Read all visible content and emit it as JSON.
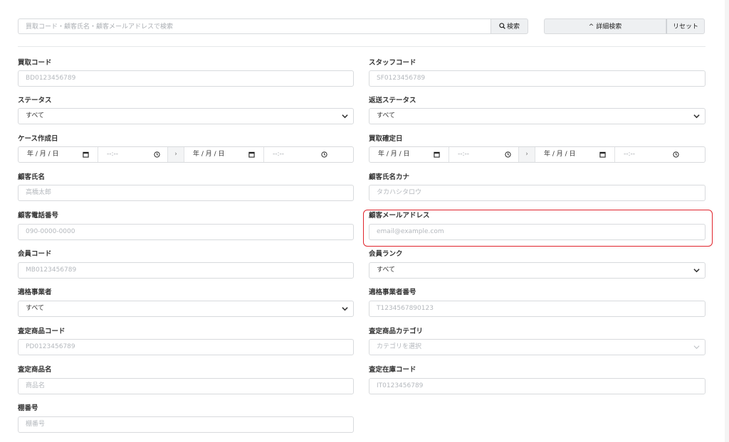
{
  "search": {
    "placeholder": "買取コード・顧客氏名・顧客メールアドレスで検索",
    "button_label": "検索",
    "advanced_label": "詳細検索",
    "reset_label": "リセット"
  },
  "fields": {
    "purchase_code": {
      "label": "買取コード",
      "placeholder": "BD0123456789"
    },
    "staff_code": {
      "label": "スタッフコード",
      "placeholder": "SF0123456789"
    },
    "status": {
      "label": "ステータス",
      "value": "すべて"
    },
    "return_status": {
      "label": "返送ステータス",
      "value": "すべて"
    },
    "case_created_date": {
      "label": "ケース作成日",
      "date_placeholder": "年 / 月 / 日",
      "time_placeholder": "--:--",
      "separator": "›"
    },
    "purchase_confirmed_date": {
      "label": "買取確定日",
      "date_placeholder": "年 / 月 / 日",
      "time_placeholder": "--:--",
      "separator": "›"
    },
    "customer_name": {
      "label": "顧客氏名",
      "placeholder": "高橋太郎"
    },
    "customer_name_kana": {
      "label": "顧客氏名カナ",
      "placeholder": "タカハシタロウ"
    },
    "customer_phone": {
      "label": "顧客電話番号",
      "placeholder": "090-0000-0000"
    },
    "customer_email": {
      "label": "顧客メールアドレス",
      "placeholder": "email@example.com"
    },
    "member_code": {
      "label": "会員コード",
      "placeholder": "MB0123456789"
    },
    "member_rank": {
      "label": "会員ランク",
      "value": "すべて"
    },
    "qualified_business": {
      "label": "適格事業者",
      "value": "すべて"
    },
    "qualified_business_number": {
      "label": "適格事業者番号",
      "placeholder": "T1234567890123"
    },
    "appraisal_product_code": {
      "label": "査定商品コード",
      "placeholder": "PD0123456789"
    },
    "appraisal_product_category": {
      "label": "査定商品カテゴリ",
      "placeholder": "カテゴリを選択"
    },
    "appraisal_product_name": {
      "label": "査定商品名",
      "placeholder": "商品名"
    },
    "appraisal_inventory_code": {
      "label": "査定在庫コード",
      "placeholder": "IT0123456789"
    },
    "shelf_number": {
      "label": "棚番号",
      "placeholder": "棚番号"
    }
  },
  "colors": {
    "highlight": "#e0242c",
    "button_bg": "#eef0f2",
    "border": "#d8dadd"
  }
}
